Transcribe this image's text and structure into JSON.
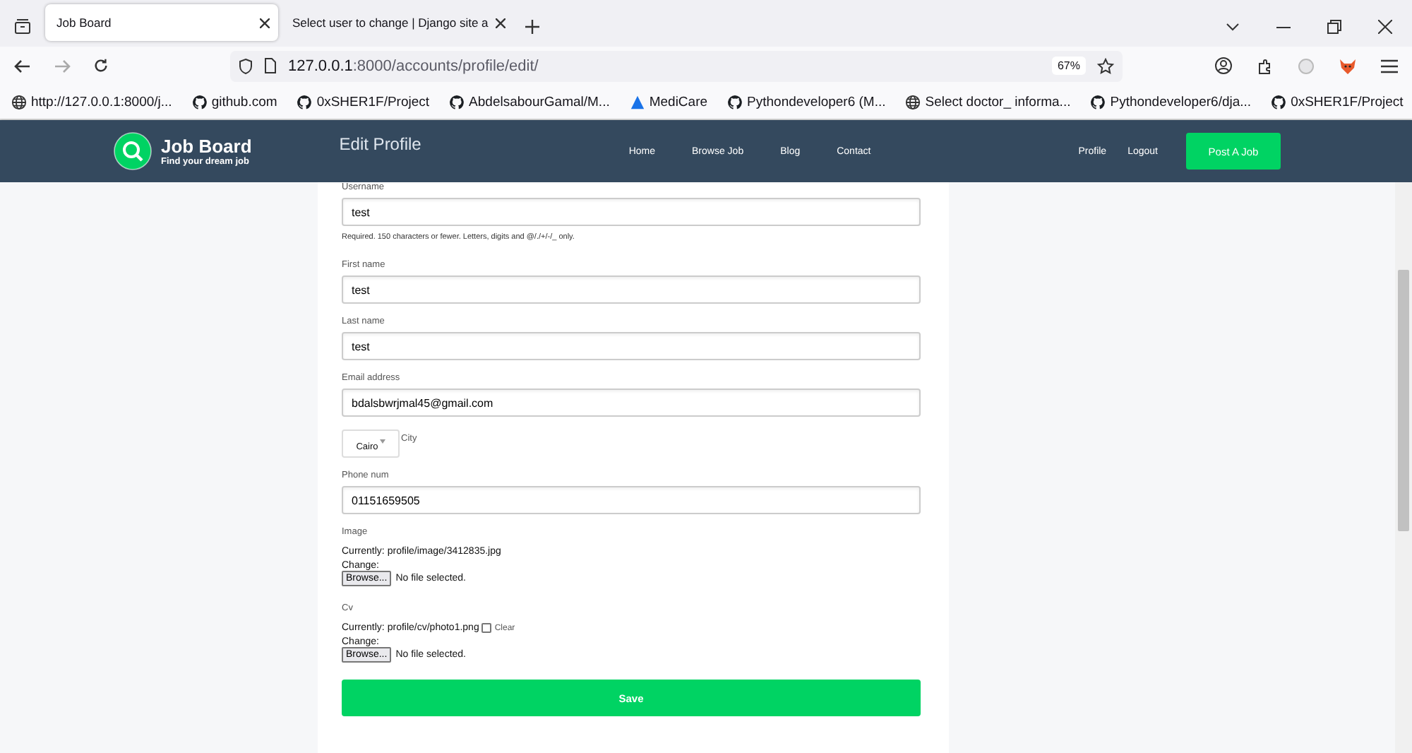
{
  "browser": {
    "tabs": [
      {
        "title": "Job Board",
        "selected": true
      },
      {
        "title": "Select user to change | Django site a",
        "selected": false
      }
    ],
    "address": {
      "host": "127.0.0.1",
      "rest": ":8000/accounts/profile/edit/"
    },
    "zoom": "67%",
    "bookmarks": [
      {
        "kind": "globe",
        "label": "http://127.0.0.1:8000/j..."
      },
      {
        "kind": "github",
        "label": "github.com"
      },
      {
        "kind": "github",
        "label": "0xSHER1F/Project"
      },
      {
        "kind": "github",
        "label": "AbdelsabourGamal/M..."
      },
      {
        "kind": "medicare",
        "label": "MediCare"
      },
      {
        "kind": "github",
        "label": "Pythondeveloper6 (M..."
      },
      {
        "kind": "globe",
        "label": "Select doctor_ informa..."
      },
      {
        "kind": "github",
        "label": "Pythondeveloper6/dja..."
      },
      {
        "kind": "github",
        "label": "0xSHER1F/Project"
      }
    ]
  },
  "site_nav": {
    "logo_title": "Job Board",
    "logo_tagline": "Find your dream job",
    "page_title": "Edit Profile",
    "links": [
      "Home",
      "Browse Job",
      "Blog",
      "Contact"
    ],
    "account_links": [
      "Profile",
      "Logout"
    ],
    "cta": "Post A Job"
  },
  "form": {
    "fields": [
      {
        "kind": "text",
        "label": "Username",
        "value": "test",
        "help": "Required. 150 characters or fewer. Letters, digits and @/./+/-/_ only."
      },
      {
        "kind": "text",
        "label": "First name",
        "value": "test"
      },
      {
        "kind": "text",
        "label": "Last name",
        "value": "test"
      },
      {
        "kind": "text",
        "label": "Email address",
        "value": "bdalsbwrjmal45@gmail.com"
      },
      {
        "kind": "select",
        "label": "City",
        "value": "Cairo"
      },
      {
        "kind": "text",
        "label": "Phone num",
        "value": "01151659505"
      },
      {
        "kind": "file",
        "label": "Image",
        "currently": "Currently:",
        "current": "profile/image/3412835.jpg",
        "change": "Change:",
        "button": "Browse...",
        "status": "No file selected."
      },
      {
        "kind": "file",
        "label": "Cv",
        "currently": "Currently:",
        "current": "profile/cv/photo1.png",
        "clear": {
          "label": "Clear",
          "checked": false
        },
        "change": "Change:",
        "button": "Browse...",
        "status": "No file selected."
      }
    ],
    "submit": "Save"
  }
}
